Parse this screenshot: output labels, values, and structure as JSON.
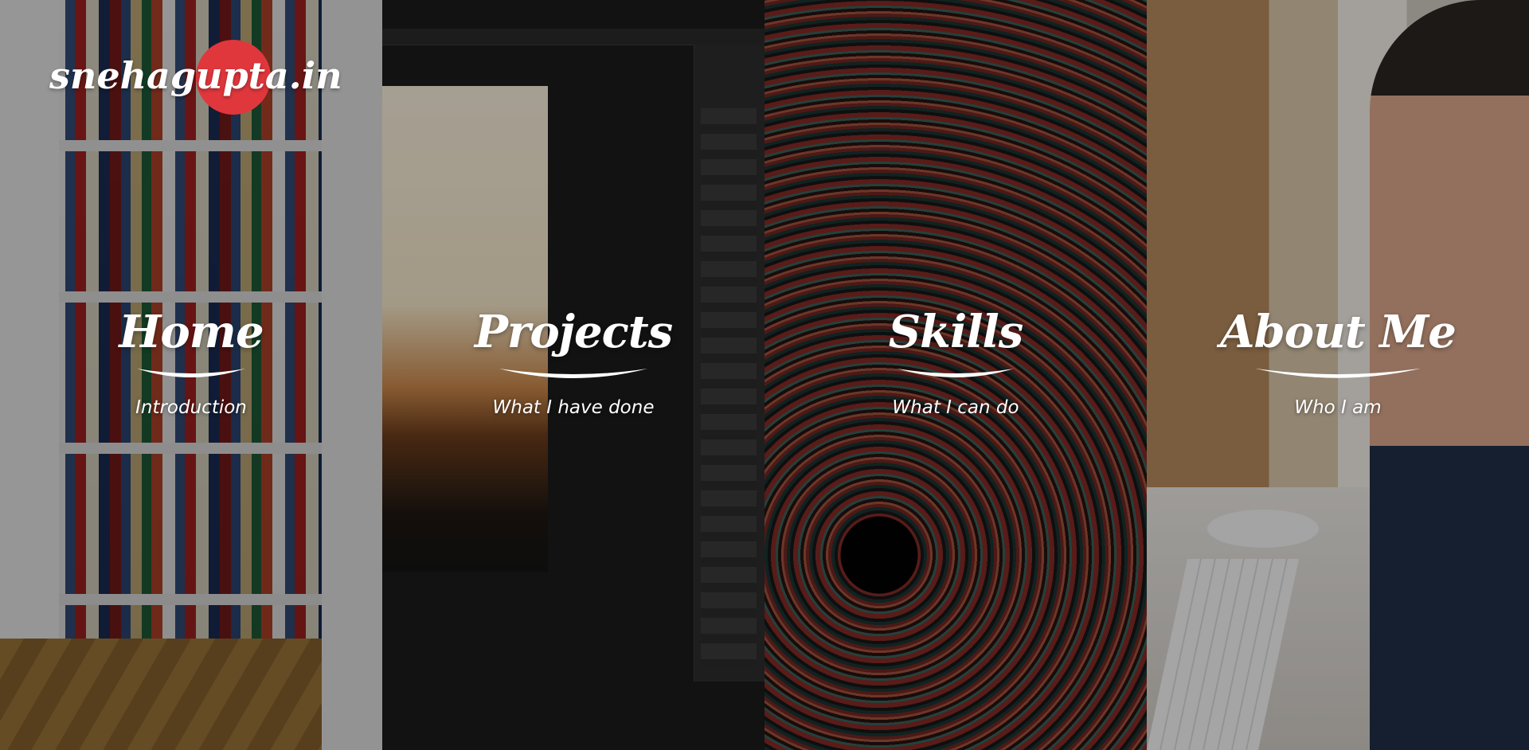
{
  "logo": {
    "text": "snehagupta.in",
    "accent_color": "#e0373c"
  },
  "panels": [
    {
      "id": "home",
      "title": "Home",
      "subtitle": "Introduction",
      "background": "bookshelf"
    },
    {
      "id": "projects",
      "title": "Projects",
      "subtitle": "What I have done",
      "background": "photoshop-workspace"
    },
    {
      "id": "skills",
      "title": "Skills",
      "subtitle": "What I can do",
      "background": "concentric-spiral"
    },
    {
      "id": "about",
      "title": "About Me",
      "subtitle": "Who I am",
      "background": "woman-at-desk"
    }
  ]
}
